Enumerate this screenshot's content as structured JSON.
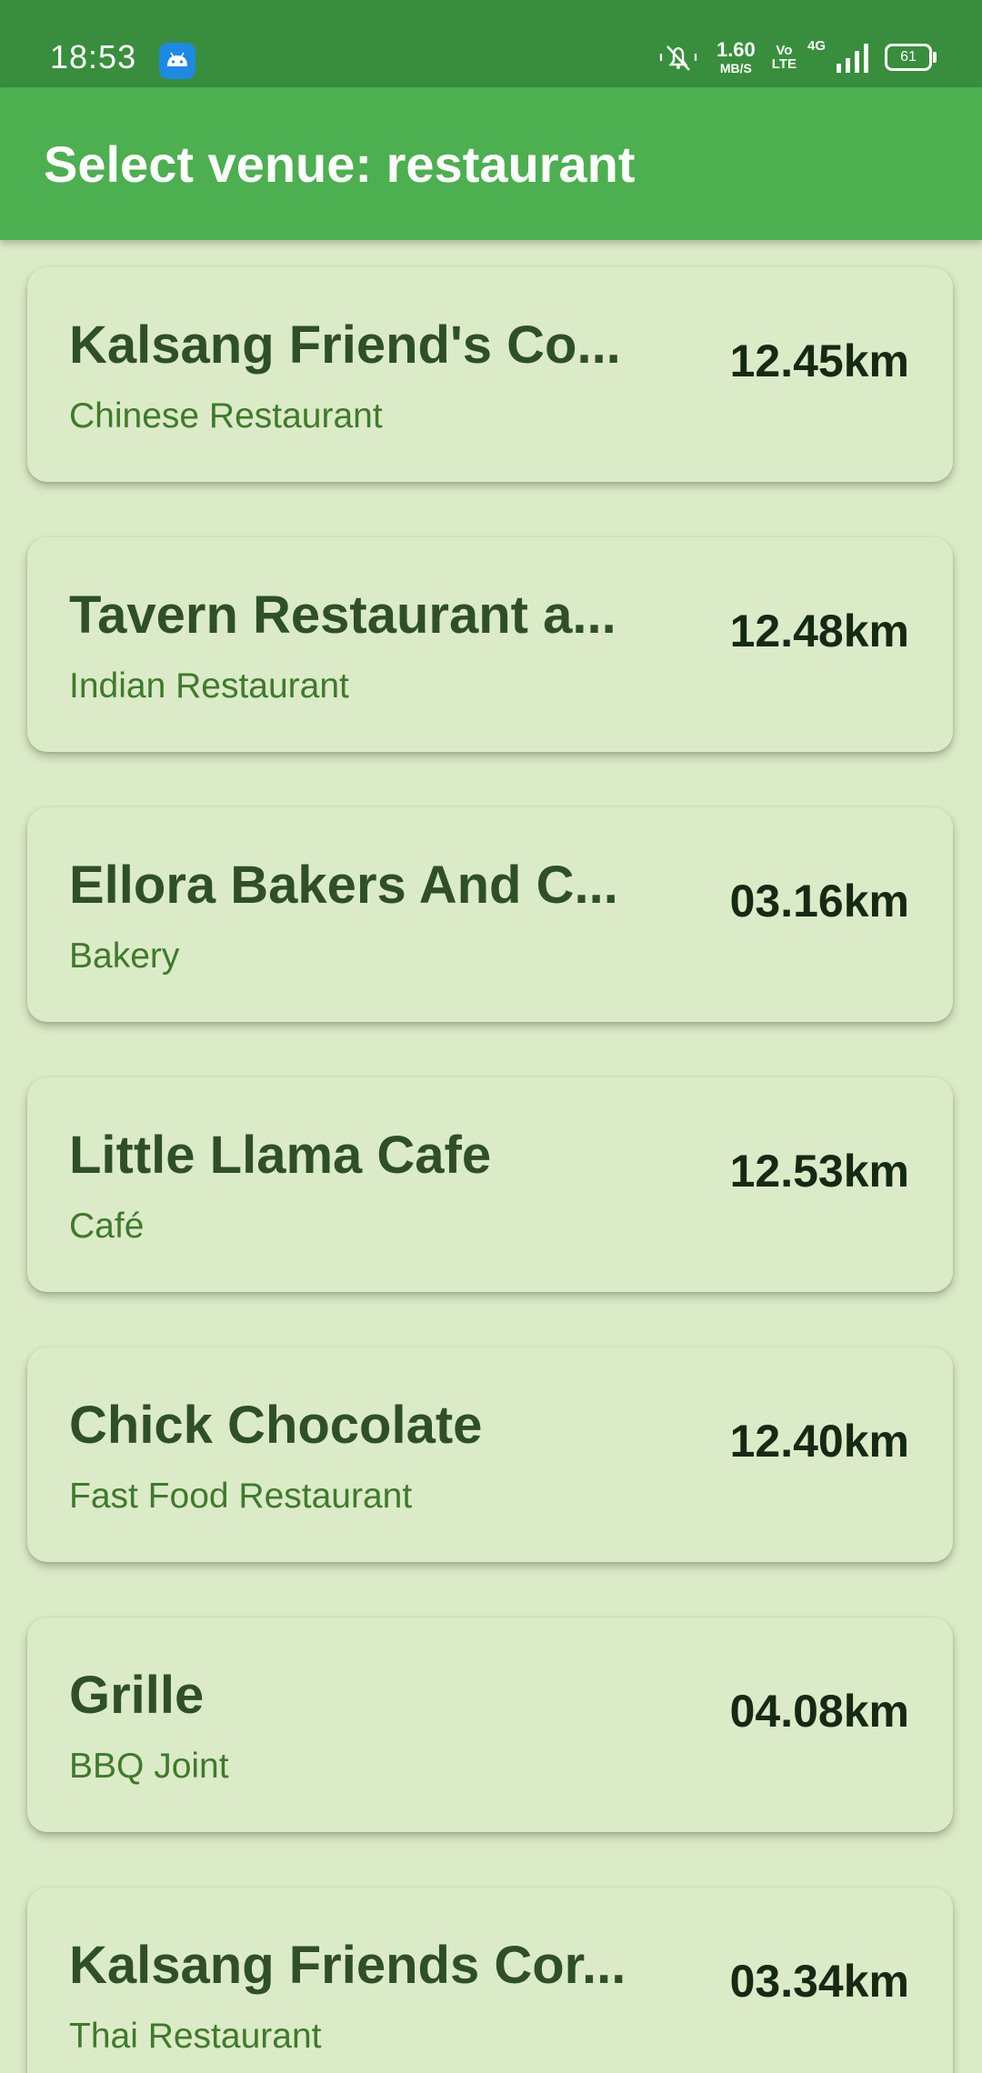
{
  "status_bar": {
    "time": "18:53",
    "net_speed_value": "1.60",
    "net_speed_unit": "MB/S",
    "volte_top": "Vo",
    "volte_bottom": "LTE",
    "network_type": "4G",
    "battery": "61",
    "icons": [
      "android-icon",
      "mute-icon",
      "signal-icon",
      "battery-icon"
    ]
  },
  "app_bar": {
    "title": "Select venue: restaurant"
  },
  "venues": [
    {
      "name": "Kalsang Friend's Co...",
      "category": "Chinese Restaurant",
      "distance": "12.45km"
    },
    {
      "name": "Tavern Restaurant a...",
      "category": "Indian Restaurant",
      "distance": "12.48km"
    },
    {
      "name": "Ellora Bakers And C...",
      "category": "Bakery",
      "distance": "03.16km"
    },
    {
      "name": "Little Llama Cafe",
      "category": "Café",
      "distance": "12.53km"
    },
    {
      "name": "Chick Chocolate",
      "category": "Fast Food Restaurant",
      "distance": "12.40km"
    },
    {
      "name": "Grille",
      "category": "BBQ Joint",
      "distance": "04.08km"
    },
    {
      "name": "Kalsang Friends Cor...",
      "category": "Thai Restaurant",
      "distance": "03.34km"
    }
  ],
  "colors": {
    "status_bar": "#388e3c",
    "app_bar": "#4caf50",
    "background": "#dcebc7",
    "name_text": "#2f4f2b",
    "category_text": "#3f7a2c",
    "distance_text": "#152a14"
  }
}
